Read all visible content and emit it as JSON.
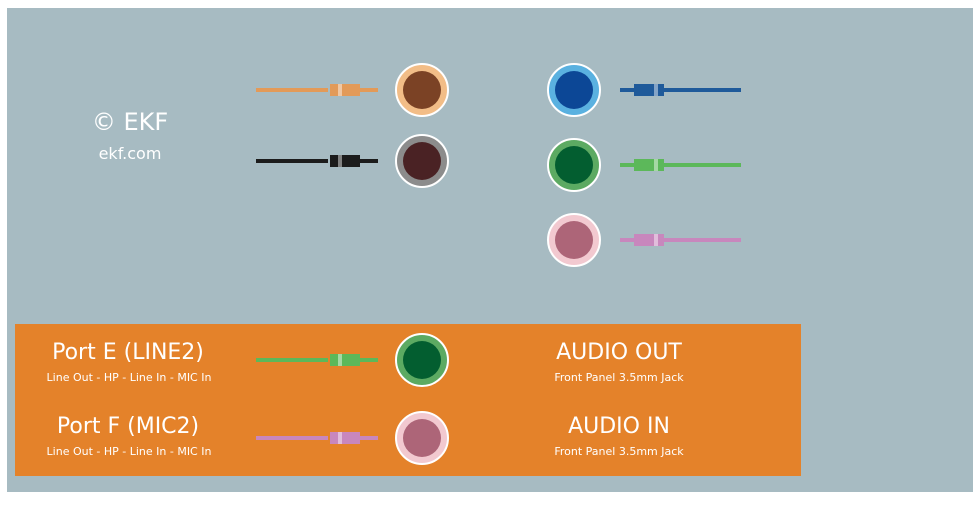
{
  "watermark": {
    "copyright": "© EKF",
    "url": "ekf.com"
  },
  "ports": [
    {
      "name": "Port E (LINE2)",
      "caption": "Line Out - HP - Line In - MIC In",
      "function": "AUDIO OUT",
      "connector": "Front Panel 3.5mm Jack",
      "color": "green"
    },
    {
      "name": "Port F (MIC2)",
      "caption": "Line Out - HP - Line In - MIC In",
      "function": "AUDIO IN",
      "connector": "Front Panel 3.5mm Jack",
      "color": "pink"
    }
  ],
  "legend_jacks": {
    "left": [
      "orange",
      "black"
    ],
    "right": [
      "blue",
      "green",
      "pink"
    ]
  },
  "colors": {
    "background": "#a7bbc2",
    "panel": "#e4822a",
    "text": "#ffffff",
    "orange": {
      "cable": "#e39a58",
      "ring": "#f2bd87",
      "core": "#7b4225"
    },
    "black": {
      "cable": "#1c1c1c",
      "ring": "#8c8c8c",
      "core": "#4a2224"
    },
    "blue": {
      "cable": "#1f5a9a",
      "ring": "#5ab1e0",
      "core": "#0c4796"
    },
    "green": {
      "cable": "#5cb85a",
      "ring": "#5caa62",
      "core": "#035e30"
    },
    "pink": {
      "cable": "#c887bd",
      "ring": "#f2c9d0",
      "core": "#ad6578"
    }
  }
}
